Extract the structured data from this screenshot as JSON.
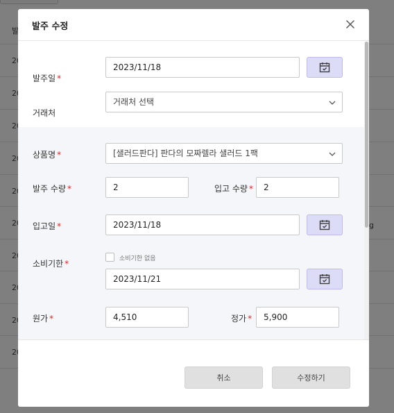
{
  "background": {
    "header_text": "발",
    "row_text": "20",
    "right_text": "g"
  },
  "modal": {
    "title": "발주 수정",
    "required_mark": "*",
    "order_date": {
      "label": "발주일",
      "value": "2023/11/18"
    },
    "vendor": {
      "label": "거래처",
      "placeholder": "거래처 선택"
    },
    "product": {
      "label": "상품명",
      "value": "[샐러드판다] 판다의 모짜렐라 샐러드 1팩"
    },
    "order_qty": {
      "label": "발주 수량",
      "value": "2"
    },
    "receive_qty": {
      "label": "입고 수량",
      "value": "2"
    },
    "receive_date": {
      "label": "입고일",
      "value": "2023/11/18"
    },
    "expiry": {
      "label": "소비기한",
      "no_expiry_label": "소비기한 없음",
      "no_expiry_checked": false,
      "value": "2023/11/21"
    },
    "cost": {
      "label": "원가",
      "value": "4,510"
    },
    "price": {
      "label": "정가",
      "value": "5,900"
    },
    "buttons": {
      "cancel": "취소",
      "submit": "수정하기"
    }
  },
  "colors": {
    "calendar_button_bg": "#dddcf7",
    "calendar_icon": "#3d3d3d",
    "required": "#e02424"
  },
  "icons": {
    "close": "close-icon",
    "calendar": "calendar-icon",
    "dropdown": "chevron-down-icon"
  }
}
